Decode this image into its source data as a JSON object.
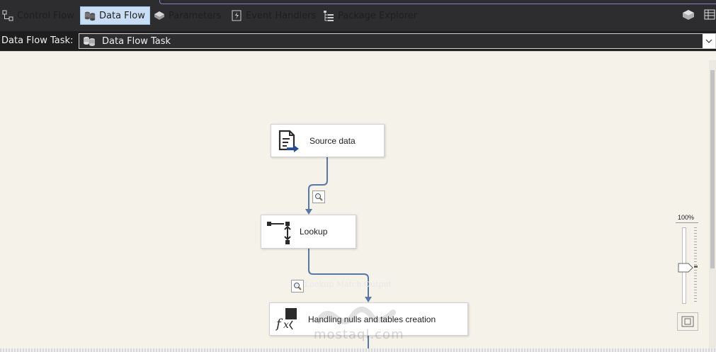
{
  "tabs": [
    {
      "label": "Control Flow",
      "icon": "control-flow-icon",
      "active": false
    },
    {
      "label": "Data Flow",
      "icon": "data-flow-icon",
      "active": true
    },
    {
      "label": "Parameters",
      "icon": "parameters-icon",
      "active": false
    },
    {
      "label": "Event Handlers",
      "icon": "event-handlers-icon",
      "active": false
    },
    {
      "label": "Package Explorer",
      "icon": "package-explorer-icon",
      "active": false
    }
  ],
  "task_selector": {
    "label": "Data Flow Task:",
    "value": "Data Flow Task"
  },
  "components": [
    {
      "label": "Source data",
      "icon": "flat-file-source-icon"
    },
    {
      "label": "Lookup",
      "icon": "lookup-icon"
    },
    {
      "label": "Handling nulls and tables creation",
      "icon": "derived-column-icon"
    }
  ],
  "flow_label": "Lookup Match Output",
  "zoom": {
    "level_text": "100%"
  },
  "watermark": {
    "text": "mostaql.com",
    "logo": "mostaql-logo"
  },
  "colors": {
    "flow_line": "#5878a8",
    "active_tab": "#c9def5",
    "canvas": "#f5f2ea"
  }
}
